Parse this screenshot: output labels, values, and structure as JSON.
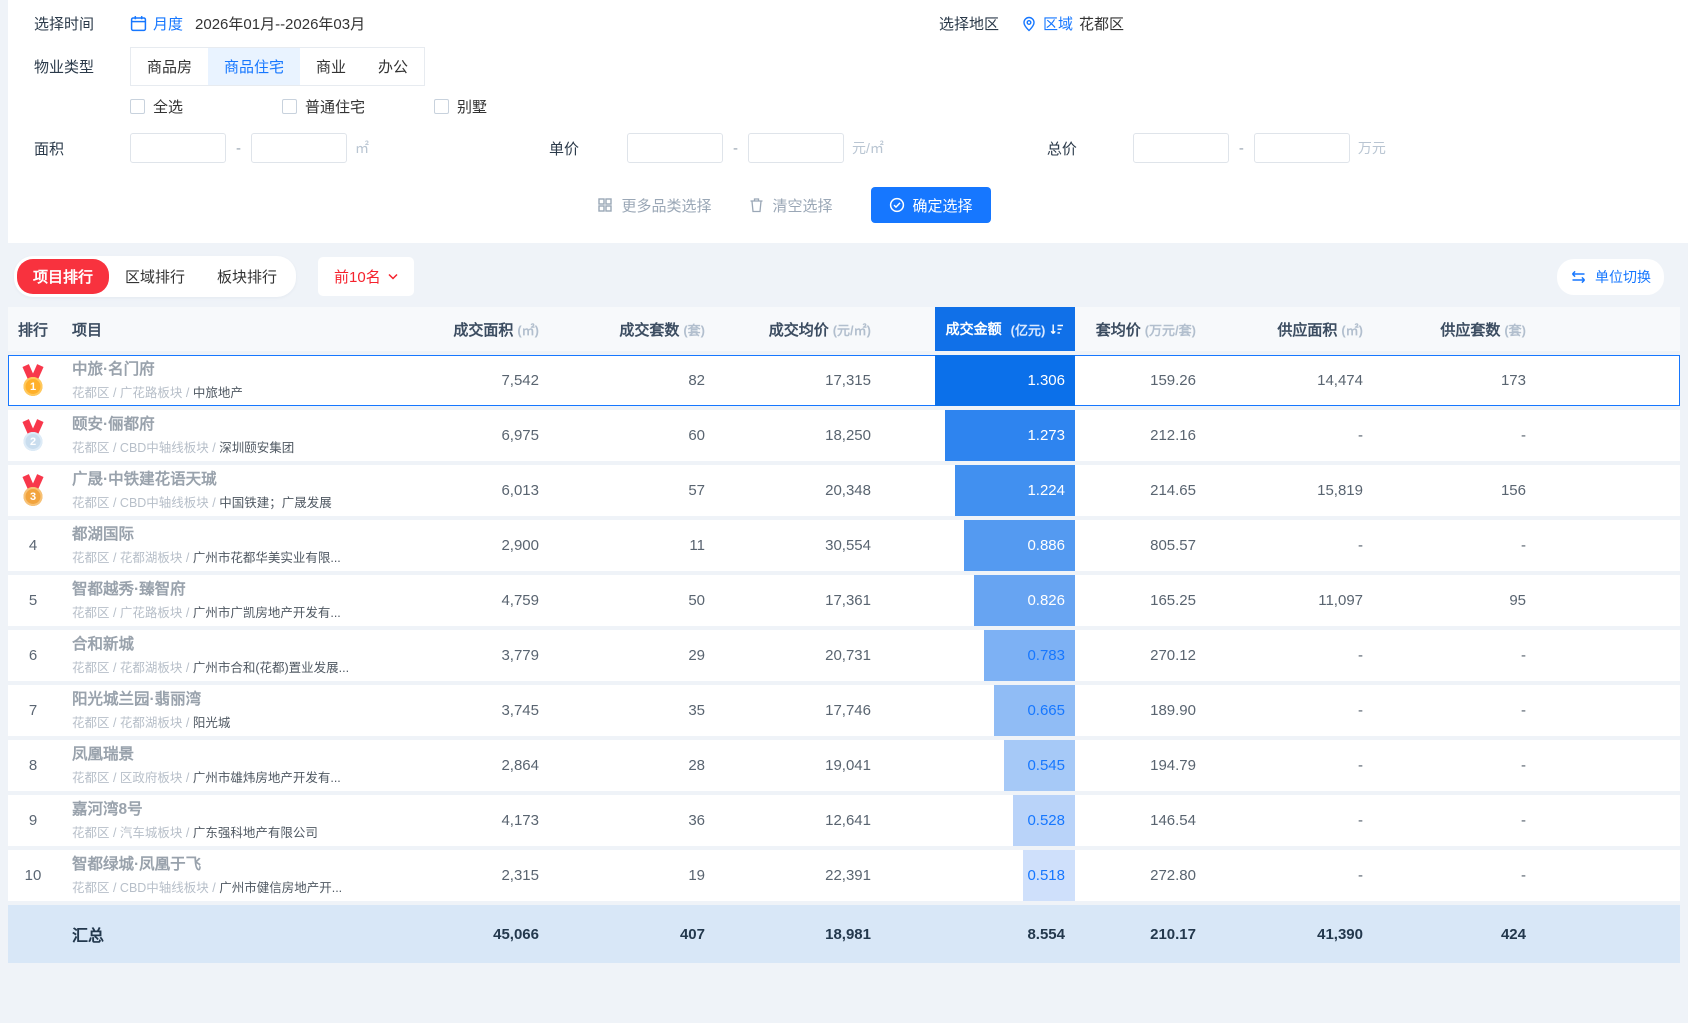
{
  "filters": {
    "separator": "-",
    "time": {
      "label": "选择时间",
      "mode": "月度",
      "range": "2026年01月--2026年03月"
    },
    "region": {
      "label": "选择地区",
      "scope": "区域",
      "value": "花都区"
    },
    "property_type": {
      "label": "物业类型",
      "tabs": [
        "商品房",
        "商品住宅",
        "商业",
        "办公"
      ],
      "active_index": 1
    },
    "subtypes": [
      {
        "label": "全选",
        "checked": false
      },
      {
        "label": "普通住宅",
        "checked": false
      },
      {
        "label": "别墅",
        "checked": false
      }
    ],
    "area": {
      "label": "面积",
      "min": "",
      "max": "",
      "unit": "㎡"
    },
    "unit_price": {
      "label": "单价",
      "min": "",
      "max": "",
      "unit": "元/㎡"
    },
    "total_price": {
      "label": "总价",
      "min": "",
      "max": "",
      "unit": "万元"
    },
    "actions": {
      "more": "更多品类选择",
      "clear": "清空选择",
      "confirm": "确定选择"
    }
  },
  "ranking": {
    "tabs": [
      "项目排行",
      "区域排行",
      "板块排行"
    ],
    "active_index": 0,
    "top_filter": "前10名",
    "unit_switch": "单位切换"
  },
  "colors": {
    "accent_blue": "#1677ff",
    "accent_red": "#f5222d",
    "header_highlight": "#1070e8",
    "summary_bg": "#d8e7f7"
  },
  "table": {
    "columns": [
      {
        "label": "排行",
        "unit": ""
      },
      {
        "label": "项目",
        "unit": ""
      },
      {
        "label": "成交面积",
        "unit": "㎡"
      },
      {
        "label": "成交套数",
        "unit": "套"
      },
      {
        "label": "成交均价",
        "unit": "元/㎡"
      },
      {
        "label": "成交金额",
        "unit": "亿元",
        "highlight": true,
        "sortable": true
      },
      {
        "label": "套均价",
        "unit": "万元/套"
      },
      {
        "label": "供应面积",
        "unit": "㎡"
      },
      {
        "label": "供应套数",
        "unit": "套"
      }
    ],
    "rows": [
      {
        "rank": 1,
        "medal": "gold",
        "name": "中旅·名门府",
        "path": "花都区 / 广花路板块 / ",
        "developer": "中旅地产",
        "deal_area": "7,542",
        "deal_units": "82",
        "deal_avg_price": "17,315",
        "deal_amount": "1.306",
        "bar_pct": 100,
        "bar_color": "#0b70ea",
        "bar_text": "#ffffff",
        "avg_total": "159.26",
        "supply_area": "14,474",
        "supply_units": "173",
        "selected": true
      },
      {
        "rank": 2,
        "medal": "silver",
        "name": "颐安·俪都府",
        "path": "花都区 / CBD中轴线板块 / ",
        "developer": "深圳颐安集团",
        "deal_area": "6,975",
        "deal_units": "60",
        "deal_avg_price": "18,250",
        "deal_amount": "1.273",
        "bar_pct": 93,
        "bar_color": "#2e84ef",
        "bar_text": "#ffffff",
        "avg_total": "212.16",
        "supply_area": "-",
        "supply_units": "-",
        "selected": false
      },
      {
        "rank": 3,
        "medal": "bronze",
        "name": "广晟·中铁建花语天珹",
        "path": "花都区 / CBD中轴线板块 / ",
        "developer": "中国铁建；广晟发展",
        "deal_area": "6,013",
        "deal_units": "57",
        "deal_avg_price": "20,348",
        "deal_amount": "1.224",
        "bar_pct": 86,
        "bar_color": "#4190f0",
        "bar_text": "#ffffff",
        "avg_total": "214.65",
        "supply_area": "15,819",
        "supply_units": "156",
        "selected": false
      },
      {
        "rank": 4,
        "medal": null,
        "name": "都湖国际",
        "path": "花都区 / 花都湖板块 / ",
        "developer": "广州市花都华美实业有限...",
        "deal_area": "2,900",
        "deal_units": "11",
        "deal_avg_price": "30,554",
        "deal_amount": "0.886",
        "bar_pct": 79,
        "bar_color": "#549af1",
        "bar_text": "#ffffff",
        "avg_total": "805.57",
        "supply_area": "-",
        "supply_units": "-",
        "selected": false
      },
      {
        "rank": 5,
        "medal": null,
        "name": "智都越秀·臻智府",
        "path": "花都区 / 广花路板块 / ",
        "developer": "广州市广凯房地产开发有...",
        "deal_area": "4,759",
        "deal_units": "50",
        "deal_avg_price": "17,361",
        "deal_amount": "0.826",
        "bar_pct": 72,
        "bar_color": "#67a4f2",
        "bar_text": "#ffffff",
        "avg_total": "165.25",
        "supply_area": "11,097",
        "supply_units": "95",
        "selected": false
      },
      {
        "rank": 6,
        "medal": null,
        "name": "合和新城",
        "path": "花都区 / 花都湖板块 / ",
        "developer": "广州市合和(花都)置业发展...",
        "deal_area": "3,779",
        "deal_units": "29",
        "deal_avg_price": "20,731",
        "deal_amount": "0.783",
        "bar_pct": 65,
        "bar_color": "#7db1f4",
        "bar_text": "#1677ff",
        "avg_total": "270.12",
        "supply_area": "-",
        "supply_units": "-",
        "selected": false
      },
      {
        "rank": 7,
        "medal": null,
        "name": "阳光城兰园·翡丽湾",
        "path": "花都区 / 花都湖板块 / ",
        "developer": "阳光城",
        "deal_area": "3,745",
        "deal_units": "35",
        "deal_avg_price": "17,746",
        "deal_amount": "0.665",
        "bar_pct": 58,
        "bar_color": "#90bcf5",
        "bar_text": "#1677ff",
        "avg_total": "189.90",
        "supply_area": "-",
        "supply_units": "-",
        "selected": false
      },
      {
        "rank": 8,
        "medal": null,
        "name": "凤凰瑞景",
        "path": "花都区 / 区政府板块 / ",
        "developer": "广州市雄炜房地产开发有...",
        "deal_area": "2,864",
        "deal_units": "28",
        "deal_avg_price": "19,041",
        "deal_amount": "0.545",
        "bar_pct": 51,
        "bar_color": "#a6c9f7",
        "bar_text": "#1677ff",
        "avg_total": "194.79",
        "supply_area": "-",
        "supply_units": "-",
        "selected": false
      },
      {
        "rank": 9,
        "medal": null,
        "name": "嘉河湾8号",
        "path": "花都区 / 汽车城板块 / ",
        "developer": "广东强科地产有限公司",
        "deal_area": "4,173",
        "deal_units": "36",
        "deal_avg_price": "12,641",
        "deal_amount": "0.528",
        "bar_pct": 44,
        "bar_color": "#b9d3f9",
        "bar_text": "#1677ff",
        "avg_total": "146.54",
        "supply_area": "-",
        "supply_units": "-",
        "selected": false
      },
      {
        "rank": 10,
        "medal": null,
        "name": "智都绿城·凤凰于飞",
        "path": "花都区 / CBD中轴线板块 / ",
        "developer": "广州市健信房地产开...",
        "deal_area": "2,315",
        "deal_units": "19",
        "deal_avg_price": "22,391",
        "deal_amount": "0.518",
        "bar_pct": 37,
        "bar_color": "#cfe0fb",
        "bar_text": "#1677ff",
        "avg_total": "272.80",
        "supply_area": "-",
        "supply_units": "-",
        "selected": false
      }
    ],
    "summary": {
      "label": "汇总",
      "deal_area": "45,066",
      "deal_units": "407",
      "deal_avg_price": "18,981",
      "deal_amount": "8.554",
      "avg_total": "210.17",
      "supply_area": "41,390",
      "supply_units": "424"
    }
  }
}
